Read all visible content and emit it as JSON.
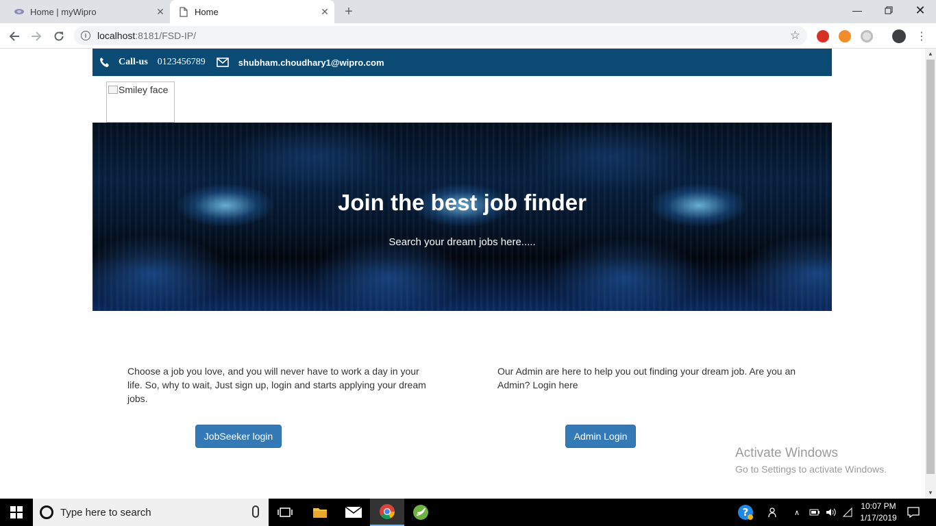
{
  "browser": {
    "tabs": [
      {
        "title": "Home | myWipro",
        "active": false
      },
      {
        "title": "Home",
        "active": true
      }
    ],
    "url_host": "localhost",
    "url_path": ":8181/FSD-IP/"
  },
  "topbar": {
    "call_label": "Call-us",
    "phone": "0123456789",
    "email": "shubham.choudhary1@wipro.com"
  },
  "logo": {
    "alt": "Smiley face"
  },
  "hero": {
    "title": "Join the best job finder",
    "subtitle": "Search your dream jobs here....."
  },
  "sections": {
    "left": {
      "text": "Choose a job you love, and you will never have to work a day in your life. So, why to wait, Just sign up, login and starts applying your dream jobs.",
      "button": "JobSeeker login"
    },
    "right": {
      "text": "Our Admin are here to help you out finding your dream job. Are you an Admin? Login here",
      "button": "Admin Login"
    }
  },
  "watermark": {
    "title": "Activate Windows",
    "subtitle": "Go to Settings to activate Windows."
  },
  "taskbar": {
    "search_placeholder": "Type here to search",
    "time": "10:07 PM",
    "date": "1/17/2019"
  },
  "colors": {
    "topbar": "#0a4a73",
    "button": "#337ab7"
  }
}
